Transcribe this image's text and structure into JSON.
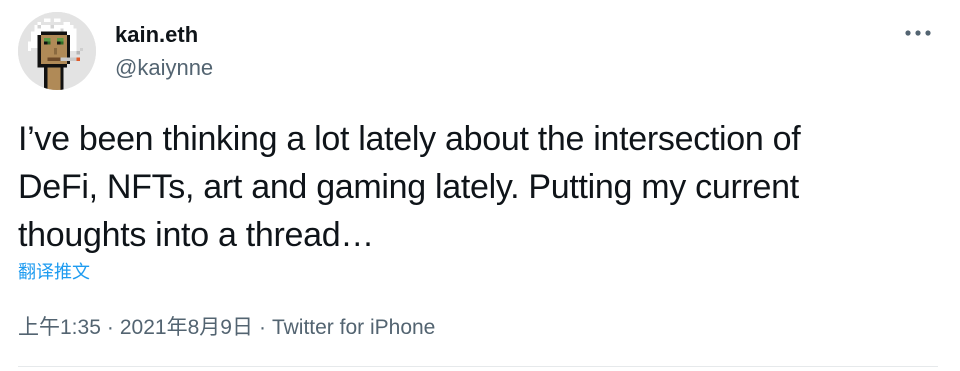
{
  "author": {
    "display_name": "kain.eth",
    "handle": "@kaiynne",
    "avatar_icon": "pixel-punk-avatar-icon"
  },
  "more_icon": "more-horizontal-icon",
  "tweet": {
    "lines": [
      "I’ve been thinking a lot lately about the intersection of",
      "DeFi, NFTs, art and gaming lately. Putting my current",
      "thoughts into a thread…"
    ]
  },
  "translate": {
    "label": "翻译推文"
  },
  "meta": {
    "time": "上午1:35",
    "separator": "·",
    "date": "2021年8月9日",
    "source": "Twitter for iPhone"
  },
  "colors": {
    "text_primary": "#0f1419",
    "text_secondary": "#536471",
    "link_blue": "#1d9bf0",
    "divider": "#e6e9eb"
  }
}
